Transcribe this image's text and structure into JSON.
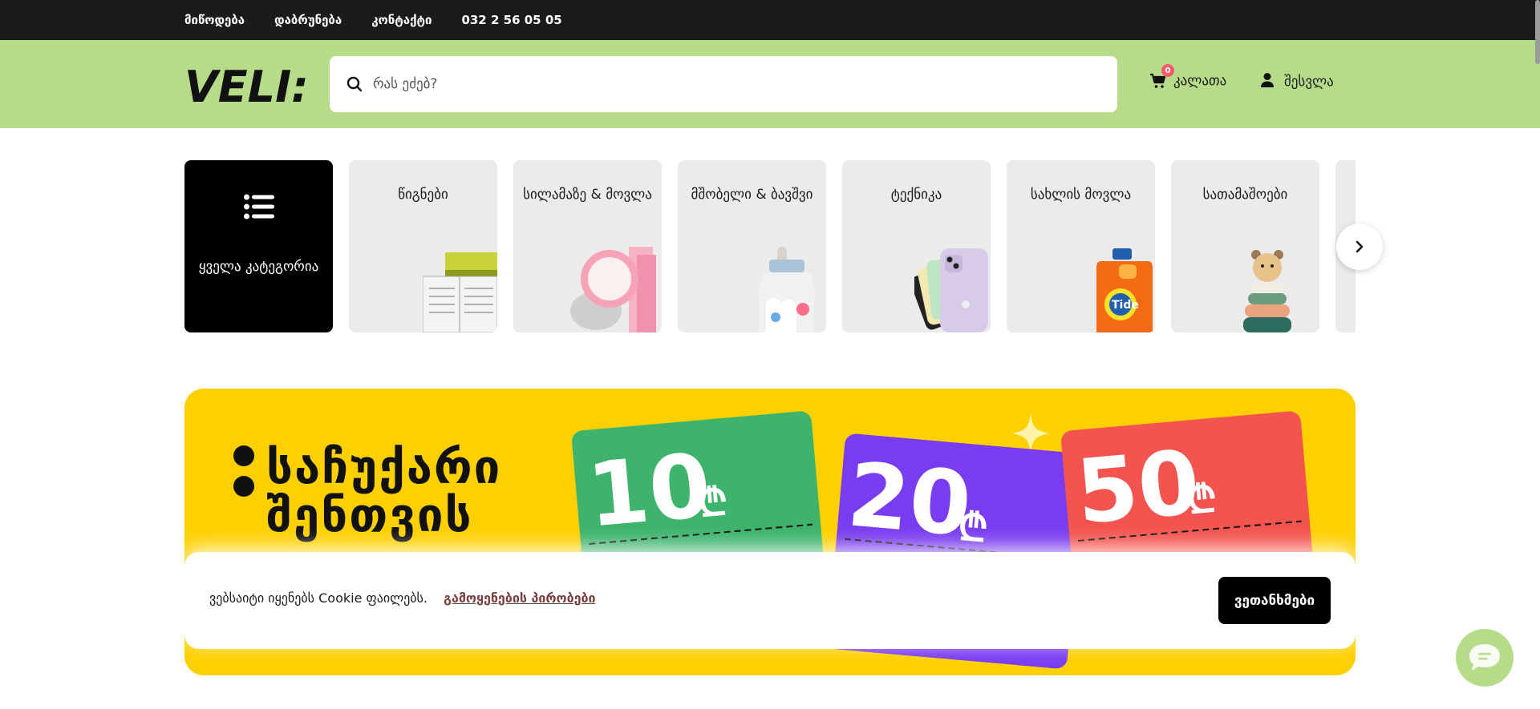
{
  "topbar": {
    "links": [
      {
        "label": "მიწოდება"
      },
      {
        "label": "დაბრუნება"
      },
      {
        "label": "კონტაქტი"
      },
      {
        "label": "032 2 56 05 05"
      }
    ]
  },
  "header": {
    "logo_text": "VELI:",
    "search_placeholder": "რას ეძებ?",
    "cart": {
      "label": "კალათა",
      "count": "0"
    },
    "login": {
      "label": "შესვლა"
    }
  },
  "categories": {
    "all": {
      "label": "ყველა კატეგორია",
      "icon": "list-icon"
    },
    "items": [
      {
        "label": "წიგნები",
        "icon": "book-icon"
      },
      {
        "label": "სილამაზე & მოვლა",
        "icon": "cream-jar-icon"
      },
      {
        "label": "მშობელი & ბავშვი",
        "icon": "baby-bottle-icon"
      },
      {
        "label": "ტექნიკა",
        "icon": "phone-icon"
      },
      {
        "label": "სახლის მოვლა",
        "icon": "detergent-icon"
      },
      {
        "label": "სათამაშოები",
        "icon": "toy-icon"
      }
    ],
    "next_icon": "chevron-right-icon"
  },
  "banner": {
    "title_line1": "საჩუქარი",
    "title_line2": "შენთვის",
    "coupons": [
      {
        "amount": "10",
        "currency": "₾",
        "color": "#3db36b"
      },
      {
        "amount": "20",
        "currency": "₾",
        "color": "#7a3cf0"
      },
      {
        "amount": "50",
        "currency": "₾",
        "color": "#f4544f"
      }
    ],
    "background": "#ffd000"
  },
  "cookie": {
    "text": "ვებსაიტი იყენებს Cookie ფაილებს.",
    "link": "გამოყენების პირობები",
    "agree": "ვეთანხმები"
  },
  "colors": {
    "header_bg": "#b6dc8a",
    "topbar_bg": "#1b1b1b",
    "accent": "#ffd000"
  }
}
